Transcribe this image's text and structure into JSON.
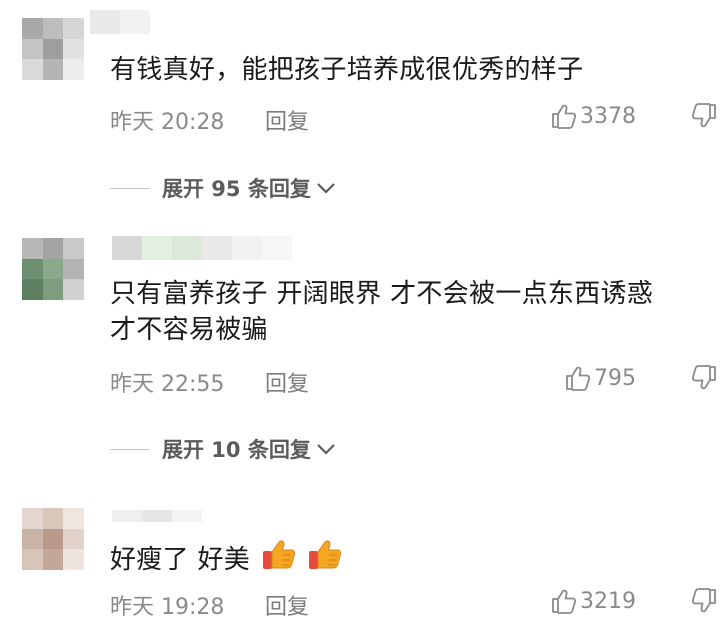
{
  "comments": [
    {
      "text": "有钱真好，能把孩子培养成很优秀的样子",
      "time": "昨天 20:28",
      "reply_label": "回复",
      "likes": "3378",
      "expand_label": "展开 95 条回复"
    },
    {
      "text_line1": "只有富养孩子 开阔眼界 才不会被一点东西诱惑",
      "text_line2": "才不容易被骗",
      "time": "昨天 22:55",
      "reply_label": "回复",
      "likes": "795",
      "expand_label": "展开 10 条回复"
    },
    {
      "text": "好瘦了  好美",
      "time": "昨天 19:28",
      "reply_label": "回复",
      "likes": "3219"
    }
  ],
  "icons": {
    "like": "thumbs-up-outline-icon",
    "dislike": "thumbs-down-outline-icon",
    "expand_chevron": "chevron-down-icon",
    "emoji": "thumbs-up-emoji-icon"
  },
  "colors": {
    "meta_text": "#8a8a8a",
    "comment_text": "#1a1a1a",
    "expand_text": "#5b5b5b",
    "emoji_orange": "#f5a623",
    "emoji_red": "#e64b3c"
  }
}
